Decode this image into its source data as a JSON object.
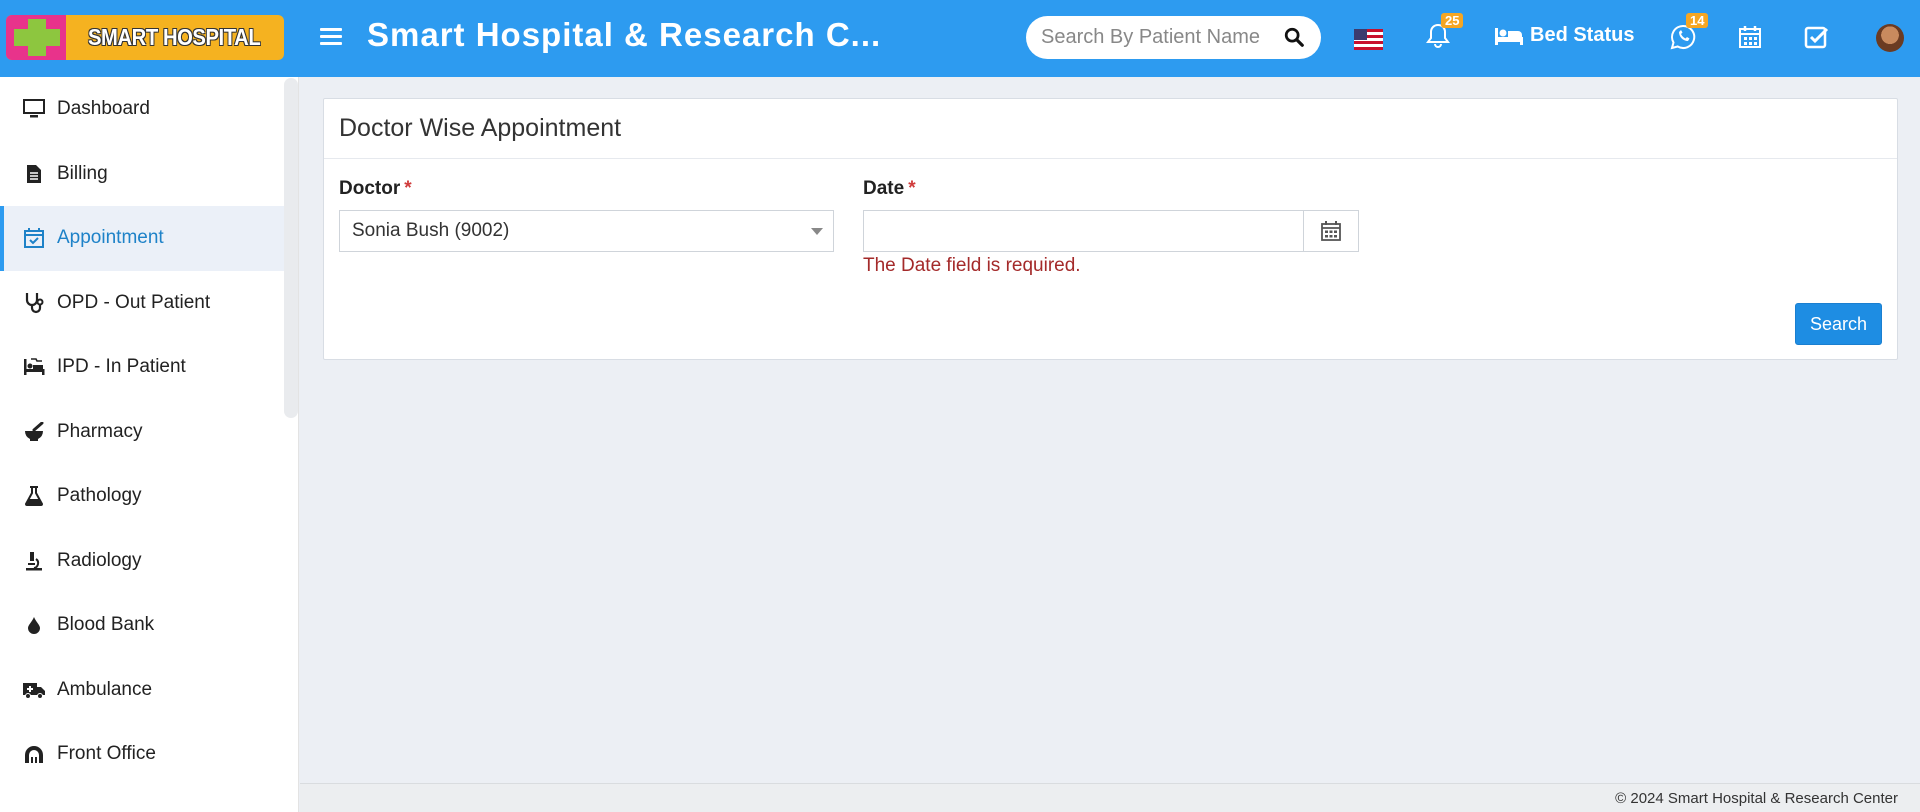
{
  "header": {
    "logo_text": "SMART HOSPITAL",
    "app_title": "Smart Hospital & Research C...",
    "search_placeholder": "Search By Patient Name",
    "notifications_count": "25",
    "bed_status_label": "Bed Status",
    "whatsapp_count": "14",
    "icons": [
      "menu-icon",
      "search-icon",
      "us-flag-icon",
      "bell-icon",
      "bed-icon",
      "whatsapp-icon",
      "calendar-icon",
      "task-check-icon",
      "avatar"
    ]
  },
  "sidebar": {
    "items": [
      {
        "label": "Dashboard",
        "icon": "monitor-icon",
        "active": false
      },
      {
        "label": "Billing",
        "icon": "document-icon",
        "active": false
      },
      {
        "label": "Appointment",
        "icon": "calendar-check-icon",
        "active": true
      },
      {
        "label": "OPD - Out Patient",
        "icon": "stethoscope-icon",
        "active": false
      },
      {
        "label": "IPD - In Patient",
        "icon": "procedures-icon",
        "active": false
      },
      {
        "label": "Pharmacy",
        "icon": "mortar-pestle-icon",
        "active": false
      },
      {
        "label": "Pathology",
        "icon": "flask-icon",
        "active": false
      },
      {
        "label": "Radiology",
        "icon": "microscope-icon",
        "active": false
      },
      {
        "label": "Blood Bank",
        "icon": "blood-drop-icon",
        "active": false
      },
      {
        "label": "Ambulance",
        "icon": "ambulance-icon",
        "active": false
      },
      {
        "label": "Front Office",
        "icon": "dungeon-icon",
        "active": false
      }
    ]
  },
  "panel": {
    "title": "Doctor Wise Appointment",
    "doctor_label": "Doctor",
    "doctor_value": "Sonia Bush (9002)",
    "date_label": "Date",
    "required_mark": "*",
    "date_value": "",
    "date_error": "The Date field is required.",
    "search_button": "Search"
  },
  "footer": {
    "copyright": "© 2024 Smart Hospital & Research Center"
  },
  "colors": {
    "header_bg": "#2d9bf0",
    "active_item": "#1e82c8",
    "error": "#a42a2a",
    "button": "#1e8de3",
    "badge": "#f5a623"
  }
}
